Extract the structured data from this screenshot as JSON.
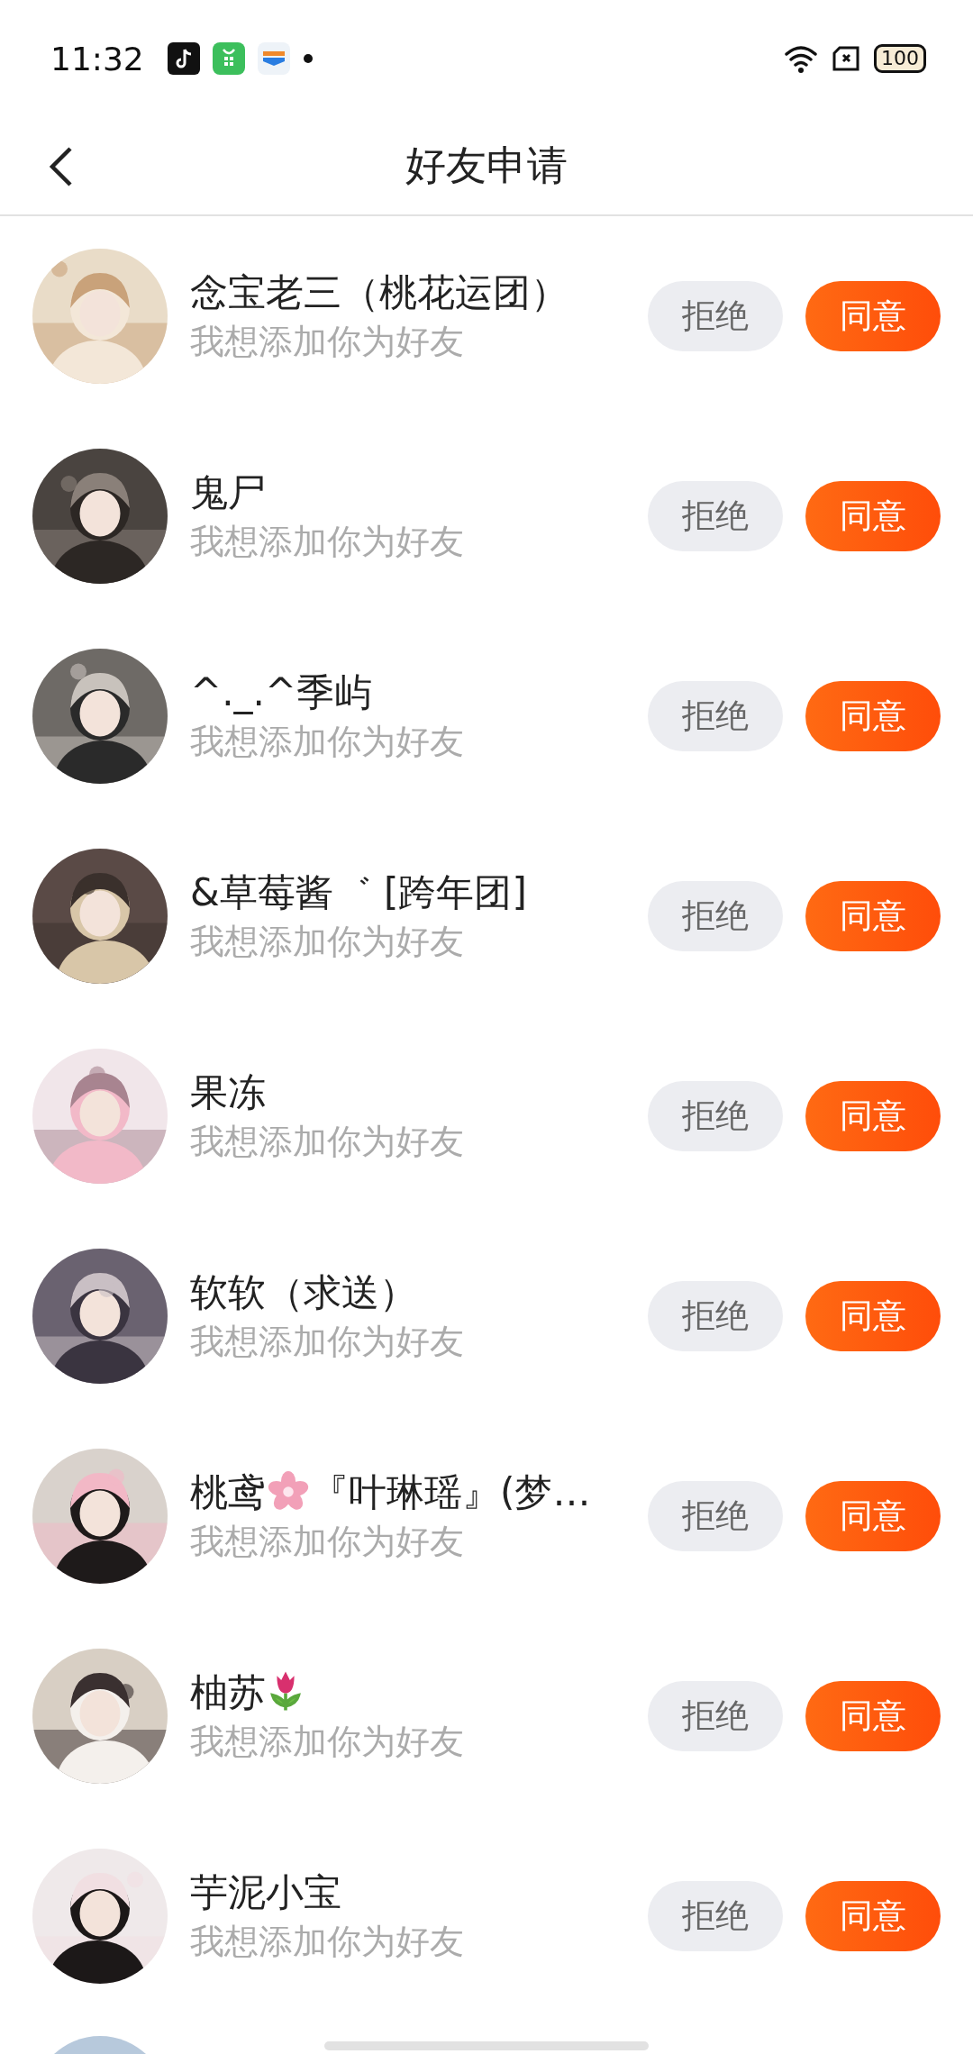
{
  "status_bar": {
    "time": "11:32",
    "battery": "100"
  },
  "header": {
    "title": "好友申请"
  },
  "requests": [
    {
      "name": [
        {
          "kind": "text",
          "text": "念宝老三（桃花运团）"
        }
      ],
      "message": "我想添加你为好友",
      "reject": "拒绝",
      "accept": "同意",
      "avatar": {
        "kind": "picture"
      }
    },
    {
      "name": [
        {
          "kind": "text",
          "text": "鬼尸"
        }
      ],
      "message": "我想添加你为好友",
      "reject": "拒绝",
      "accept": "同意",
      "avatar": {
        "kind": "picture"
      }
    },
    {
      "name": [
        {
          "kind": "text",
          "text": "^._.^季屿"
        }
      ],
      "message": "我想添加你为好友",
      "reject": "拒绝",
      "accept": "同意",
      "avatar": {
        "kind": "picture"
      }
    },
    {
      "name": [
        {
          "kind": "text",
          "text": "&草莓酱゛ [跨年团]"
        }
      ],
      "message": "我想添加你为好友",
      "reject": "拒绝",
      "accept": "同意",
      "avatar": {
        "kind": "picture"
      }
    },
    {
      "name": [
        {
          "kind": "text",
          "text": "果冻"
        }
      ],
      "message": "我想添加你为好友",
      "reject": "拒绝",
      "accept": "同意",
      "avatar": {
        "kind": "picture"
      }
    },
    {
      "name": [
        {
          "kind": "text",
          "text": "软软（求送）"
        }
      ],
      "message": "我想添加你为好友",
      "reject": "拒绝",
      "accept": "同意",
      "avatar": {
        "kind": "picture"
      }
    },
    {
      "name": [
        {
          "kind": "text",
          "text": "桃鸢"
        },
        {
          "kind": "blossom"
        },
        {
          "kind": "text",
          "text": "『叶琳瑶』(梦…"
        }
      ],
      "message": "我想添加你为好友",
      "reject": "拒绝",
      "accept": "同意",
      "avatar": {
        "kind": "picture"
      }
    },
    {
      "name": [
        {
          "kind": "text",
          "text": "柚苏"
        },
        {
          "kind": "tulip"
        }
      ],
      "message": "我想添加你为好友",
      "reject": "拒绝",
      "accept": "同意",
      "avatar": {
        "kind": "picture"
      }
    },
    {
      "name": [
        {
          "kind": "text",
          "text": "芋泥小宝"
        }
      ],
      "message": "我想添加你为好友",
      "reject": "拒绝",
      "accept": "同意",
      "avatar": {
        "kind": "picture"
      }
    }
  ],
  "partial_row": {
    "avatar": {
      "kind": "picture"
    }
  }
}
